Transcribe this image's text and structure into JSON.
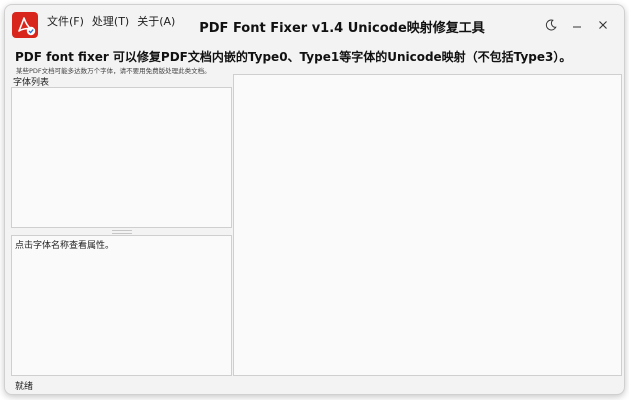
{
  "app": {
    "title": "PDF Font Fixer v1.4  Unicode映射修复工具",
    "icon": "pdf-acrobat-icon",
    "brand_color": "#d9261c"
  },
  "menu": {
    "items": [
      {
        "label": "文件(F)"
      },
      {
        "label": "处理(T)"
      },
      {
        "label": "关于(A)"
      }
    ]
  },
  "window_controls": {
    "theme_icon": "moon-icon",
    "minimize_icon": "minimize-icon",
    "close_icon": "close-icon"
  },
  "header": {
    "headline": "PDF font fixer 可以修复PDF文档内嵌的Type0、Type1等字体的Unicode映射（不包括Type3）。",
    "note": "某些PDF文档可能多达数万个字体，请不要用免费版处理此类文档。"
  },
  "font_list": {
    "label": "字体列表"
  },
  "properties": {
    "hint": "点击字体名称查看属性。"
  },
  "status": {
    "text": "就绪"
  }
}
